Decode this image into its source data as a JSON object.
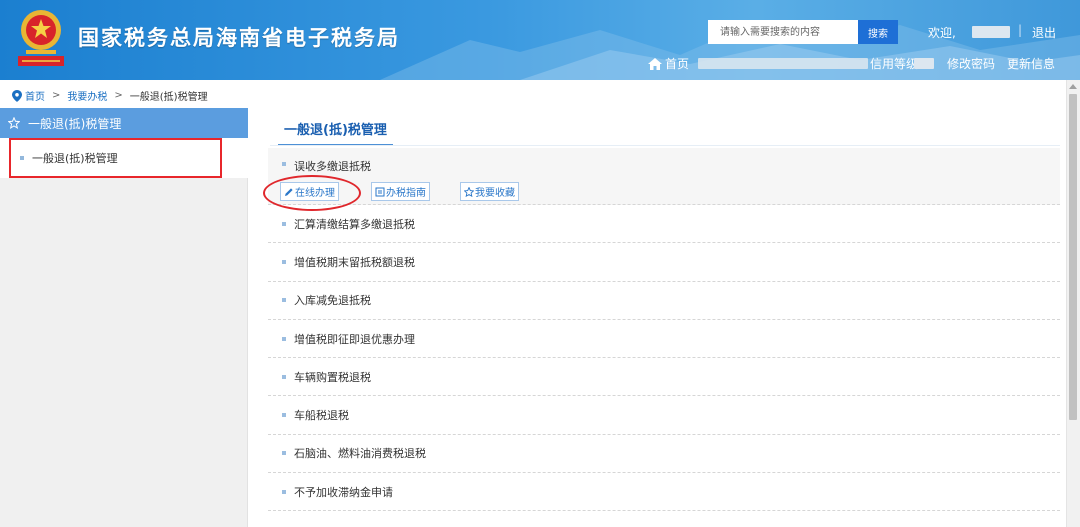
{
  "header": {
    "site_title": "国家税务总局海南省电子税务局",
    "search_placeholder": "请输入需要搜索的内容",
    "search_button": "搜索",
    "welcome": "欢迎,",
    "separator": "|",
    "logout": "退出",
    "home": "首页",
    "credit_rating": "信用等级",
    "change_password": "修改密码",
    "update_info": "更新信息"
  },
  "breadcrumb": {
    "home": "首页",
    "sep1": ">",
    "my_tax": "我要办税",
    "sep2": ">",
    "current": "一般退(抵)税管理"
  },
  "sidebar": {
    "header": "一般退(抵)税管理",
    "items": [
      {
        "label": "一般退(抵)税管理"
      }
    ]
  },
  "main": {
    "tab": "一般退(抵)税管理",
    "items": [
      {
        "label": "误收多缴退抵税"
      },
      {
        "label": "汇算清缴结算多缴退抵税"
      },
      {
        "label": "增值税期末留抵税额退税"
      },
      {
        "label": "入库减免退抵税"
      },
      {
        "label": "增值税即征即退优惠办理"
      },
      {
        "label": "车辆购置税退税"
      },
      {
        "label": "车船税退税"
      },
      {
        "label": "石脑油、燃料油消费税退税"
      },
      {
        "label": "不予加收滞纳金申请"
      }
    ],
    "actions": {
      "online": "在线办理",
      "guide": "办税指南",
      "favorite": "我要收藏"
    }
  },
  "colors": {
    "header_blue": "#3a99e0",
    "sidebar_header": "#5b9ddf",
    "link_blue": "#1a6fc2",
    "annotation_red": "#e8262b"
  }
}
